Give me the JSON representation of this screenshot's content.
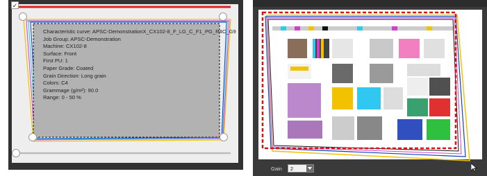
{
  "left_panel": {
    "checkbox_checked": true,
    "info_lines": [
      "Characteristic curve: APSC-DemonstrationX_CX102-8_F_LG_C_F1_PG_R4C_G9",
      "Job Group: APSC-Demonstration",
      "Machine: CX102-8",
      "Surface: Front",
      "First PU: 1",
      "Paper Grade: Coated",
      "Grain Direction: Long grain",
      "Colors: C4",
      "Grammage (g/m²): 90.0",
      "Range: 0 - 50 %"
    ],
    "colors": {
      "panel_bg": "#333333",
      "canvas_bg": "#eeeeee",
      "box_fill": "#b2b2b2",
      "red": "#e02020",
      "yellow": "#f2c200",
      "magenta": "#d040d0",
      "cyan": "#30c8f0",
      "blue": "#1040c0",
      "black": "#111111"
    }
  },
  "right_panel": {
    "gain_label": "Gain",
    "gain_value": "2",
    "colors": {
      "panel_bg": "#3a3a3a",
      "dashed_outline": "#dd1111"
    }
  }
}
